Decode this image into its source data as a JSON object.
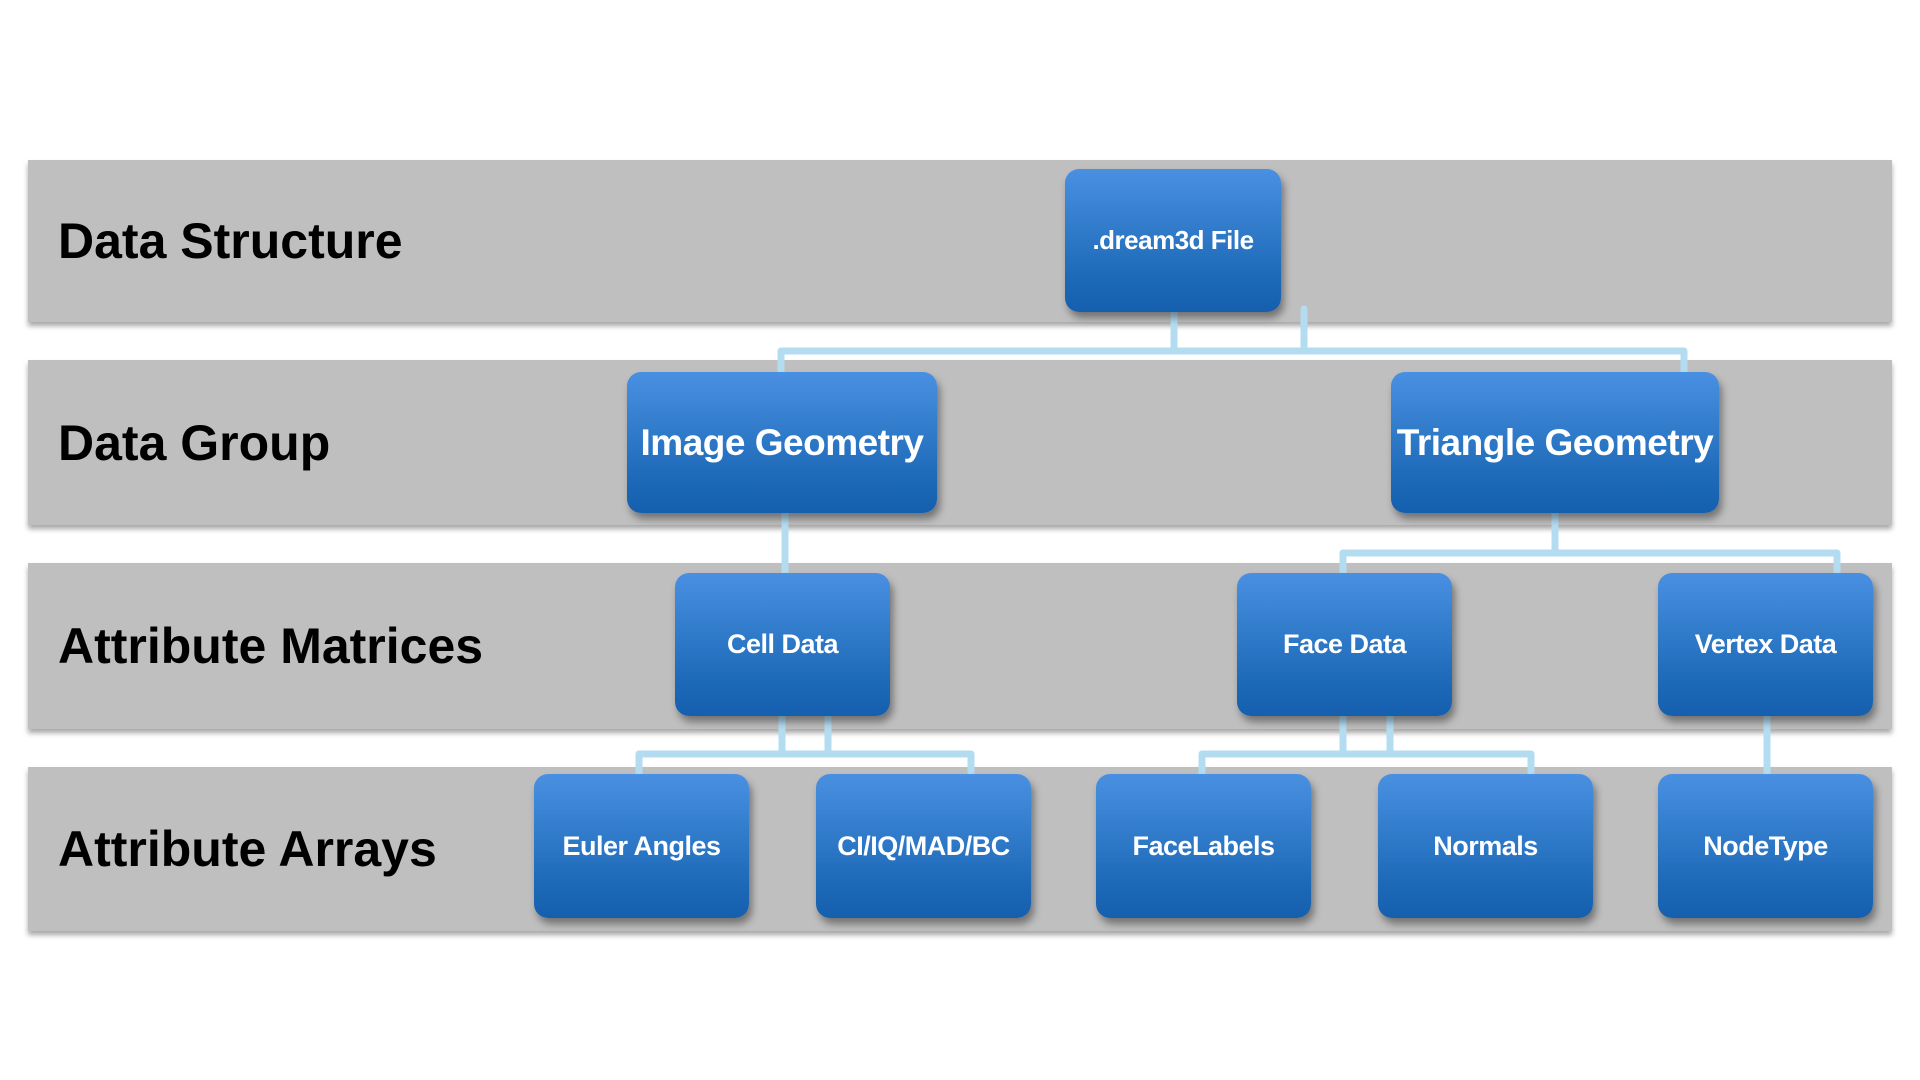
{
  "levels": [
    {
      "label": "Data Structure"
    },
    {
      "label": "Data Group"
    },
    {
      "label": "Attribute Matrices"
    },
    {
      "label": "Attribute Arrays"
    }
  ],
  "nodes": {
    "file": ".dream3d File",
    "image_geometry": "Image Geometry",
    "triangle_geometry": "Triangle Geometry",
    "cell_data": "Cell Data",
    "face_data": "Face Data",
    "vertex_data": "Vertex Data",
    "euler_angles": "Euler Angles",
    "ci_iq_mad_bc": "CI/IQ/MAD/BC",
    "face_labels": "FaceLabels",
    "normals": "Normals",
    "node_type": "NodeType"
  },
  "colors": {
    "band": "#bfbfbf",
    "node": "#2f7cd0",
    "connector": "#b3dcf1"
  }
}
